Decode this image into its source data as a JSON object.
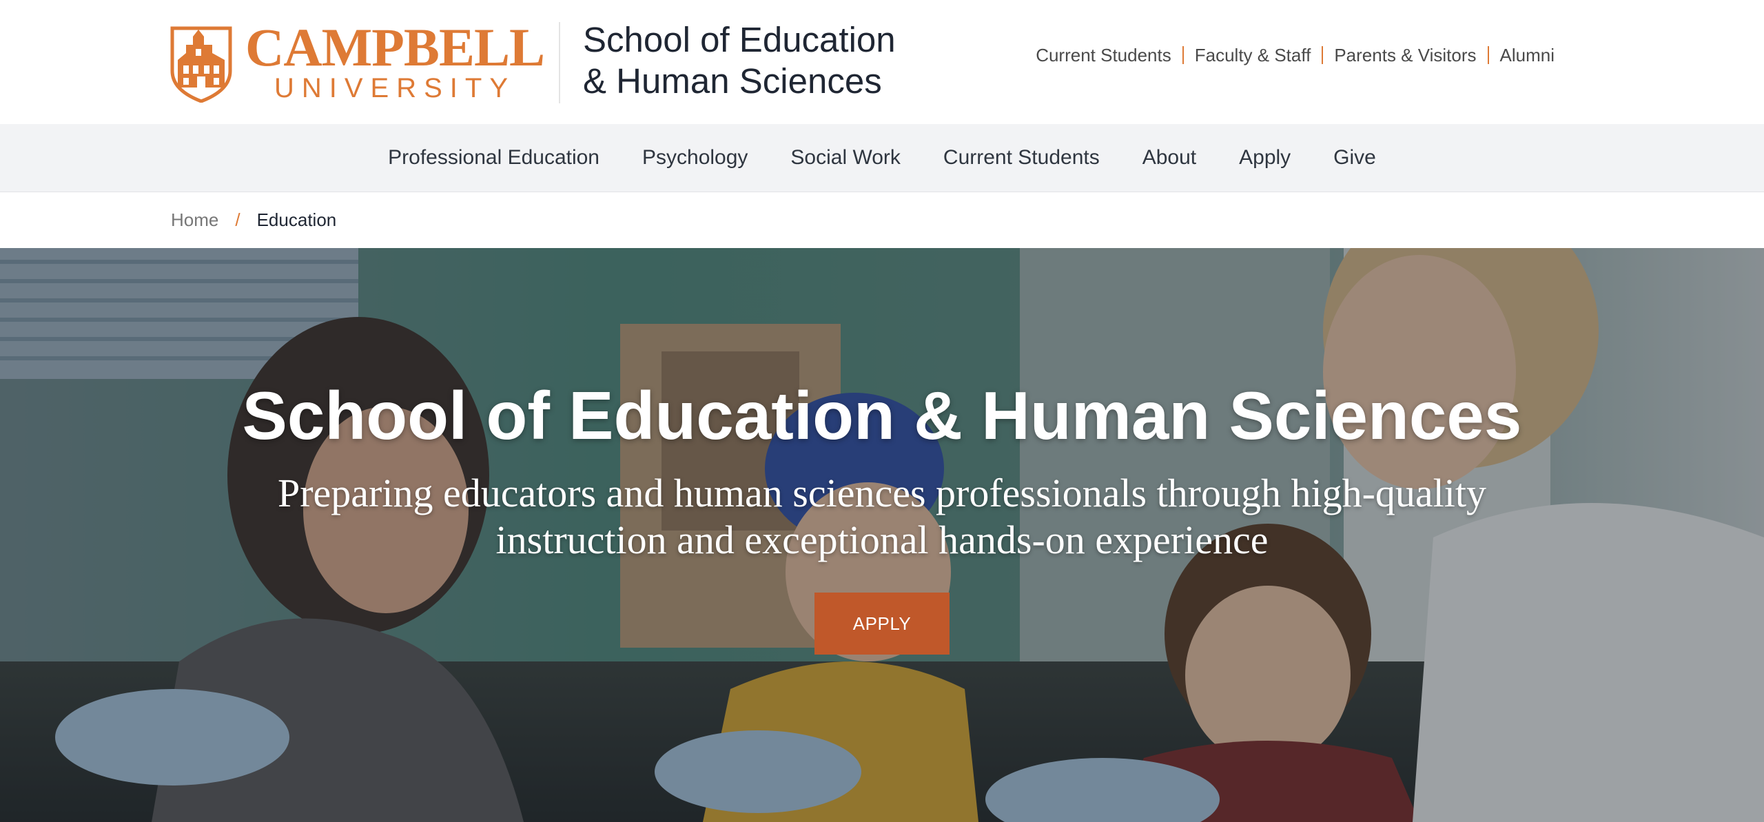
{
  "header": {
    "logo": {
      "name": "CAMPBELL",
      "sub": "UNIVERSITY"
    },
    "school_title_line1": "School of Education",
    "school_title_line2": "& Human Sciences",
    "utility_nav": [
      "Current Students",
      "Faculty & Staff",
      "Parents & Visitors",
      "Alumni"
    ]
  },
  "main_nav": {
    "items": [
      "Professional Education",
      "Psychology",
      "Social Work",
      "Current Students",
      "About",
      "Apply",
      "Give"
    ]
  },
  "breadcrumb": {
    "home": "Home",
    "separator": "/",
    "current": "Education"
  },
  "hero": {
    "title": "School of Education & Human Sciences",
    "subtitle": "Preparing educators and human sciences professionals through high-quality instruction and exceptional hands-on experience",
    "button_label": "APPLY"
  },
  "colors": {
    "brand_orange": "#de7a35",
    "button_orange": "#c0582a",
    "nav_background": "#f2f3f5",
    "title_navy": "#1f2633"
  }
}
